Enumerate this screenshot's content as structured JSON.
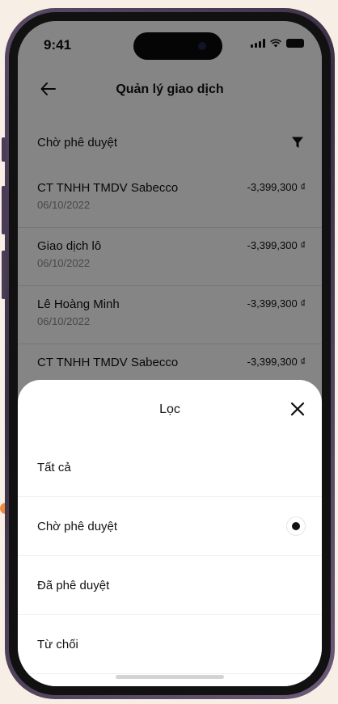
{
  "status_bar": {
    "time": "9:41"
  },
  "nav": {
    "title": "Quản lý giao dịch"
  },
  "filter": {
    "label": "Chờ phê duyệt"
  },
  "transactions": [
    {
      "name": "CT TNHH TMDV Sabecco",
      "date": "06/10/2022",
      "amount": "-3,399,300 ₫"
    },
    {
      "name": "Giao dịch lô",
      "date": "06/10/2022",
      "amount": "-3,399,300 ₫"
    },
    {
      "name": "Lê Hoàng Minh",
      "date": "06/10/2022",
      "amount": "-3,399,300 ₫"
    },
    {
      "name": "CT TNHH TMDV Sabecco",
      "date": "",
      "amount": "-3,399,300 ₫"
    }
  ],
  "sheet": {
    "title": "Lọc",
    "options": [
      {
        "label": "Tất cả",
        "selected": false
      },
      {
        "label": "Chờ phê duyệt",
        "selected": true
      },
      {
        "label": "Đã phê duyệt",
        "selected": false
      },
      {
        "label": "Từ chối",
        "selected": false
      }
    ]
  },
  "colors": {
    "accent": "#f08a3c",
    "overlay": "#00000080",
    "frame": "#4a3c56"
  },
  "icons": {
    "back": "arrow-left-icon",
    "filter": "funnel-icon",
    "close": "close-icon",
    "radio": "radio-selected-icon"
  }
}
